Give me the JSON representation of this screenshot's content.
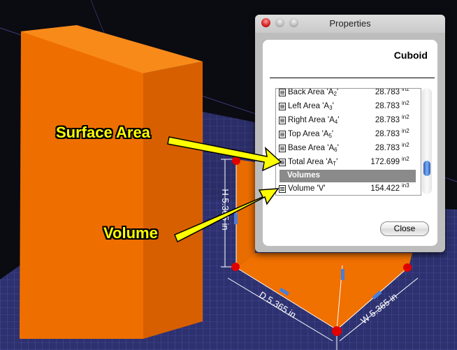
{
  "window": {
    "title": "Properties",
    "object_name": "Cuboid",
    "close_label": "Close"
  },
  "rows": [
    {
      "label": "Back Area 'A",
      "sub": "2",
      "label_end": "'",
      "value": "28.783",
      "unit": "in2"
    },
    {
      "label": "Left Area 'A",
      "sub": "3",
      "label_end": "'",
      "value": "28.783",
      "unit": "in2"
    },
    {
      "label": "Right Area 'A",
      "sub": "4",
      "label_end": "'",
      "value": "28.783",
      "unit": "in2"
    },
    {
      "label": "Top Area 'A",
      "sub": "5",
      "label_end": "'",
      "value": "28.783",
      "unit": "in2"
    },
    {
      "label": "Base Area 'A",
      "sub": "6",
      "label_end": "'",
      "value": "28.783",
      "unit": "in2"
    },
    {
      "label": "Total Area 'A",
      "sub": "T",
      "label_end": "'",
      "value": "172.699",
      "unit": "in2"
    }
  ],
  "volumes_header": "Volumes",
  "volume_row": {
    "label": "Volume 'V'",
    "value": "154.422",
    "unit": "in3"
  },
  "callouts": {
    "surface": "Surface Area",
    "volume": "Volume"
  },
  "dimensions": {
    "height": "H 5.365 in",
    "depth": "D 5.365 in",
    "width": "W 5.365 in"
  },
  "colors": {
    "cuboid_orange": "#f07000",
    "grid_blue": "#2b2f6e",
    "handle_red": "#e00000",
    "callout_yellow": "#ffff00"
  }
}
